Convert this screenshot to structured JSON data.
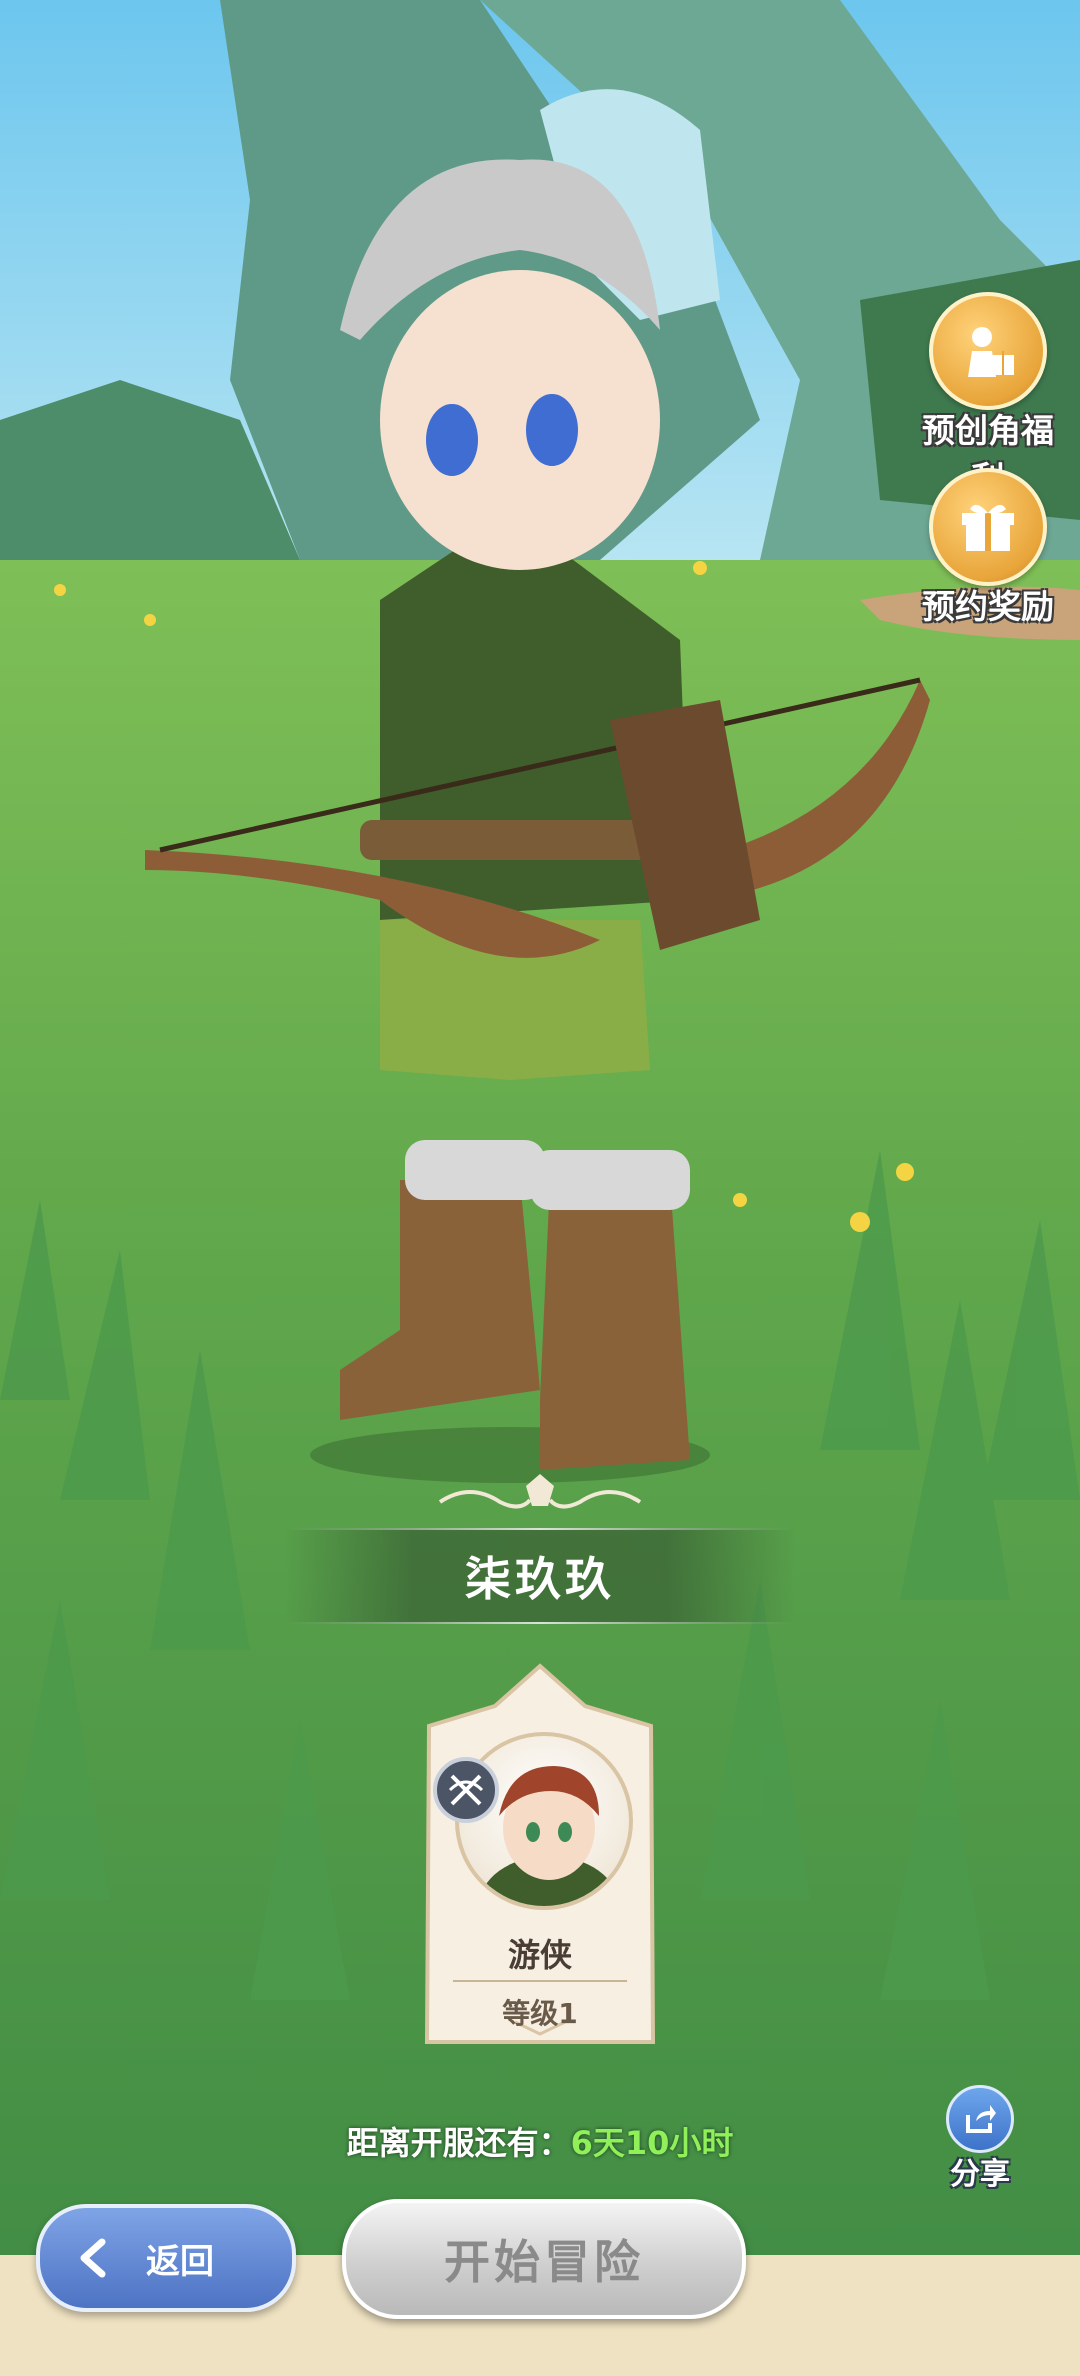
{
  "side_buttons": [
    {
      "label": "预创角福利",
      "icon": "character-gift-icon"
    },
    {
      "label": "预约奖励",
      "icon": "gift-box-icon"
    }
  ],
  "character": {
    "name": "柒玖玖"
  },
  "class_card": {
    "class_name": "游侠",
    "level": "等级1",
    "badge_icon": "crossed-bow-icon"
  },
  "countdown": {
    "label": "距离开服还有：",
    "value": "6天10小时"
  },
  "share": {
    "label": "分享"
  },
  "buttons": {
    "back": "返回",
    "start": "开始冒险"
  },
  "colors": {
    "countdown_value": "#8ff05a",
    "back_button": "#5b80cf",
    "start_button_disabled": "#c8c8c8"
  }
}
